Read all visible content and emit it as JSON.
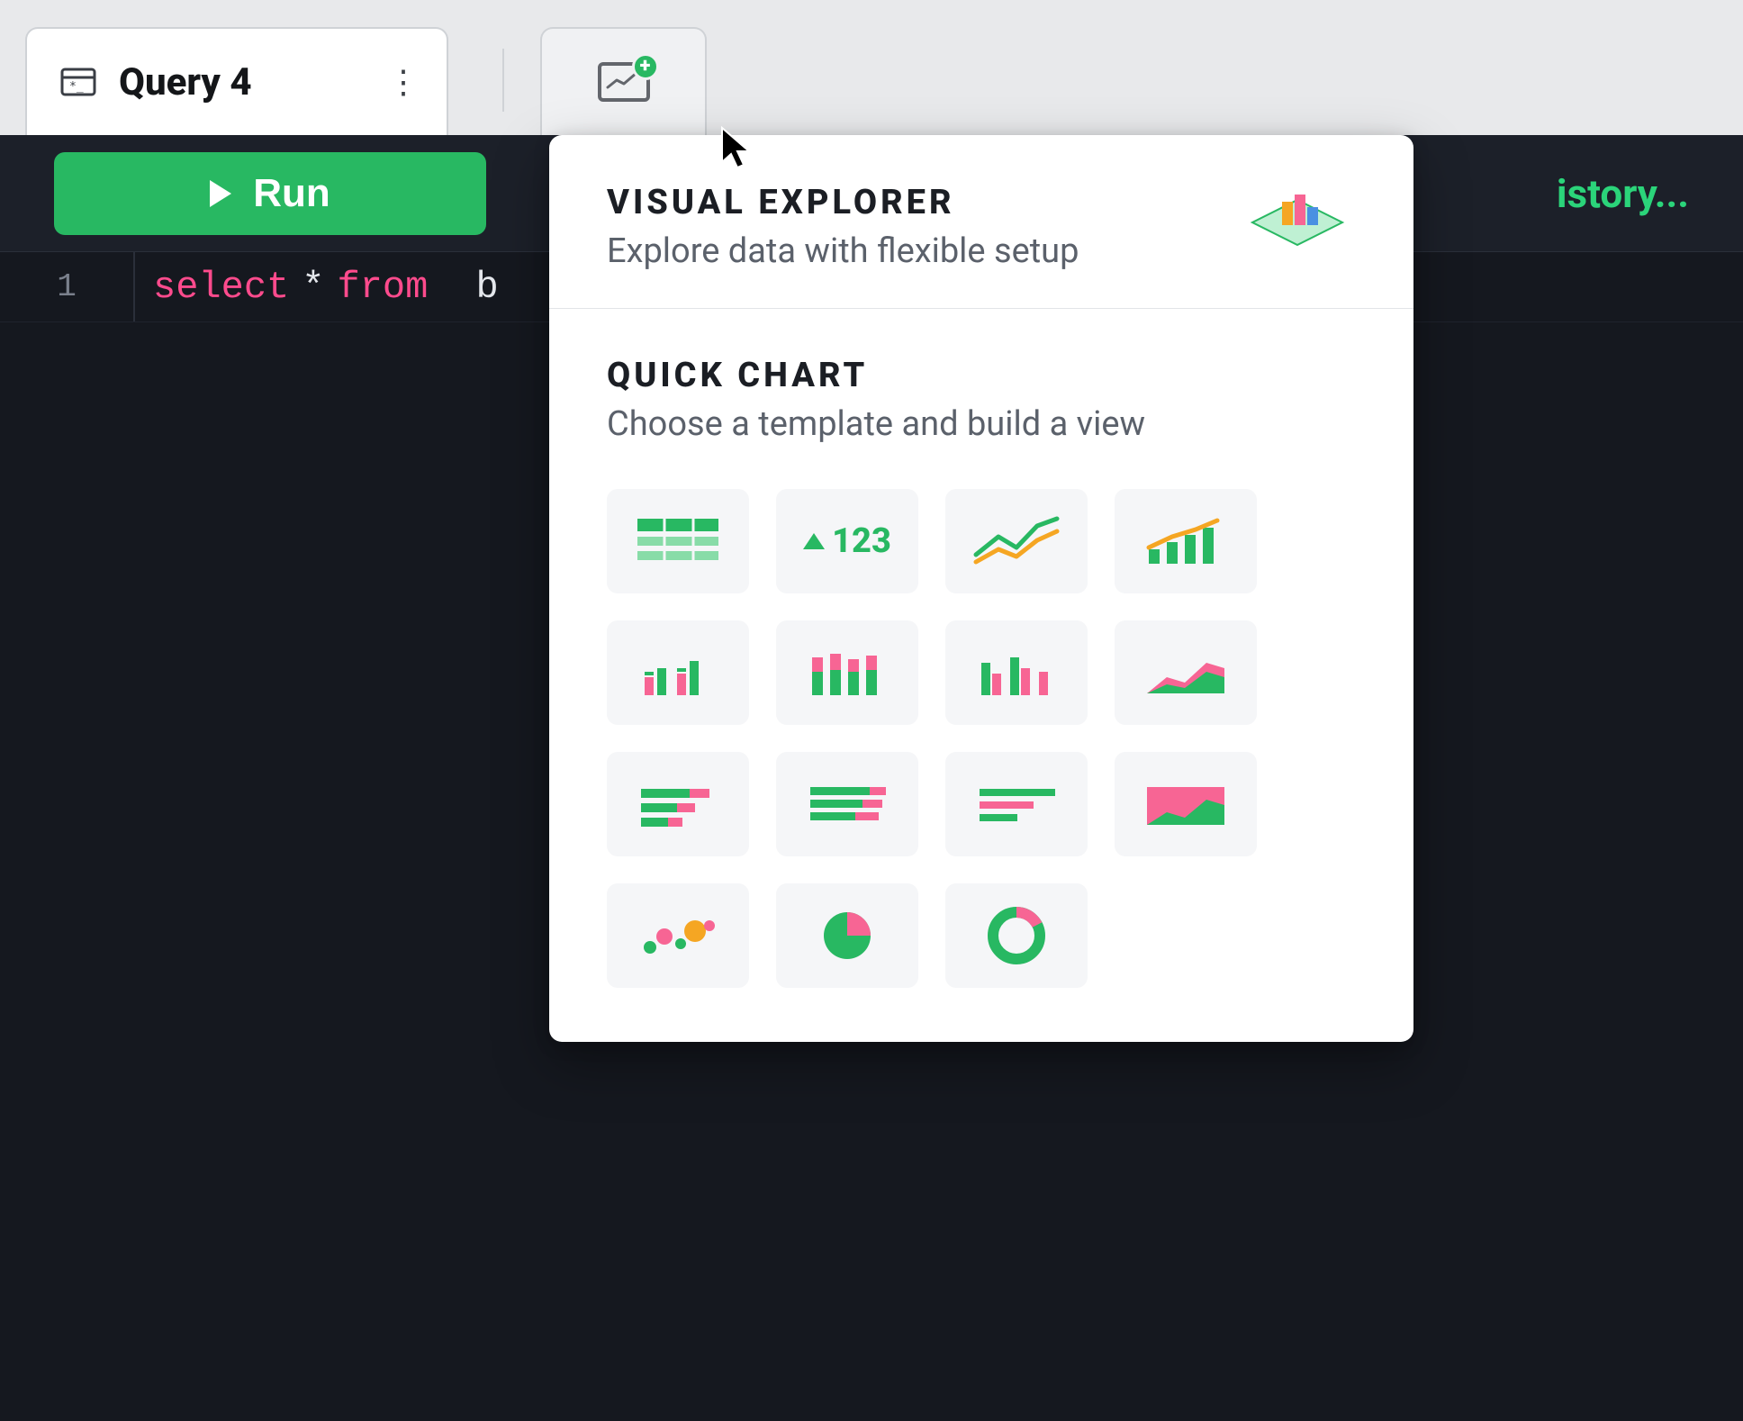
{
  "tabbar": {
    "query_tab_label": "Query 4",
    "add_chart_tooltip": "Add chart"
  },
  "toolbar": {
    "run_label": "Run",
    "history_label": "istory..."
  },
  "editor": {
    "line_number": "1",
    "tokens": {
      "select": "select",
      "star": "*",
      "from": "from",
      "table_prefix": "b"
    }
  },
  "popover": {
    "visual_explorer": {
      "title": "VISUAL EXPLORER",
      "subtitle": "Explore data with flexible setup"
    },
    "quick_chart": {
      "title": "QUICK CHART",
      "subtitle": "Choose a template and build a view",
      "big_number_label": "123"
    },
    "chart_types": [
      "table",
      "big-number",
      "line",
      "combo-bar-line",
      "bar-dual",
      "stacked-bar",
      "grouped-bar",
      "area",
      "horizontal-bar-1",
      "horizontal-bar-2",
      "horizontal-bar-3",
      "area-stacked",
      "scatter",
      "pie",
      "donut"
    ]
  },
  "colors": {
    "green": "#28b862",
    "green_light": "#88dca8",
    "pink": "#f76594",
    "orange": "#f5a623"
  }
}
